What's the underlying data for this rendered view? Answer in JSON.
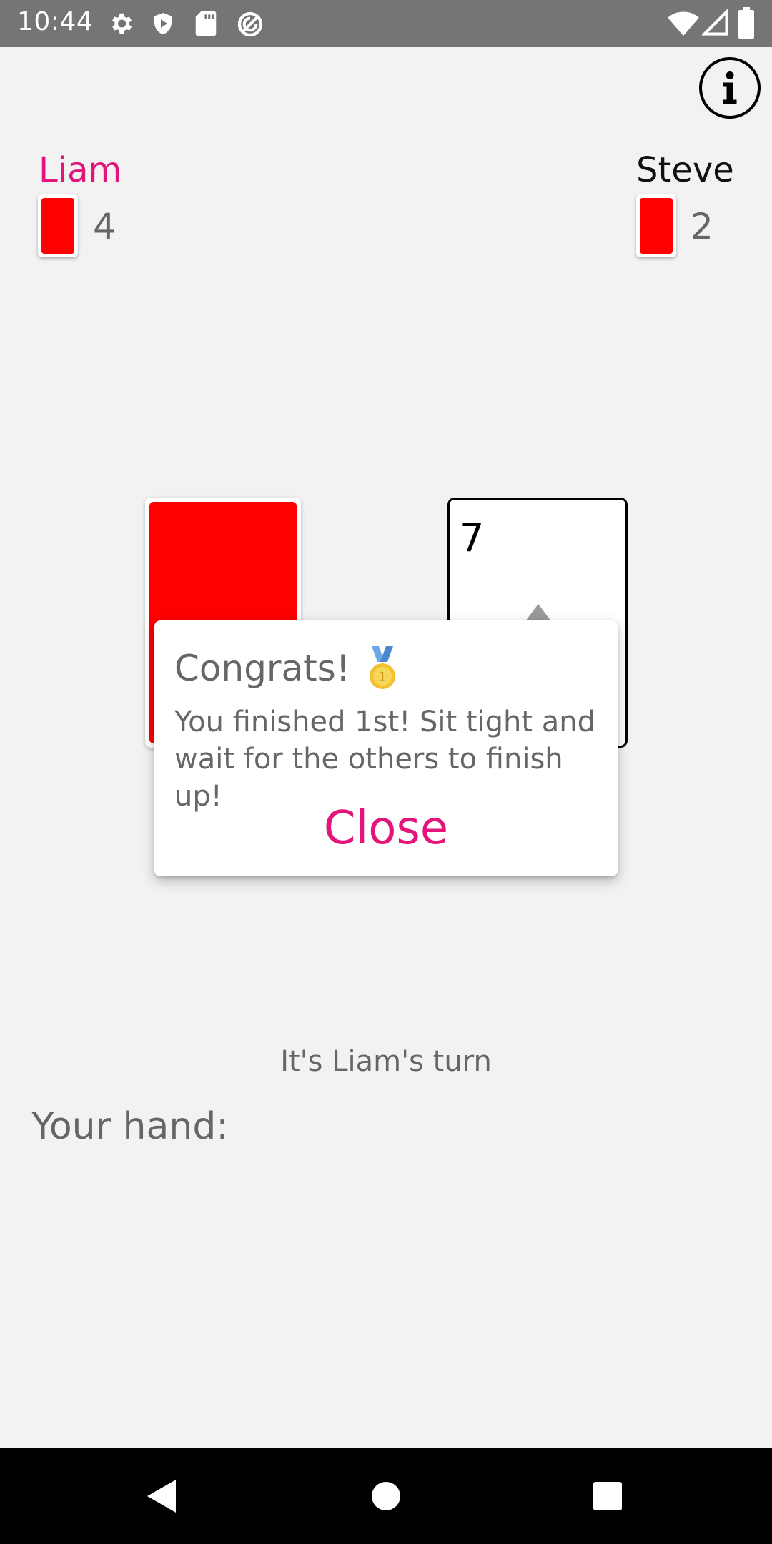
{
  "status_bar": {
    "time": "10:44",
    "left_icons": [
      "gear-icon",
      "shield-icon",
      "sd-card-icon",
      "no-sync-icon"
    ],
    "right_icons": [
      "wifi-icon",
      "signal-icon",
      "battery-icon"
    ]
  },
  "header": {
    "info_icon": "info-icon"
  },
  "players": [
    {
      "name": "Liam",
      "card_count": "4",
      "color": "#e4157a",
      "is_current_turn": true
    },
    {
      "name": "Steve",
      "card_count": "2",
      "color": "#111111",
      "is_current_turn": false
    }
  ],
  "table": {
    "deck_color": "#ff0000",
    "discard": {
      "rank": "7",
      "suit_icon": "diamond-icon",
      "suit_color": "#999999"
    }
  },
  "dialog": {
    "title": "Congrats!",
    "title_icon": "first-place-medal-icon",
    "body": "You finished 1st! Sit tight and wait for the others to finish up!",
    "close_label": "Close",
    "accent_color": "#e4157a"
  },
  "turn": {
    "text": "It's Liam's turn"
  },
  "hand": {
    "label": "Your hand:",
    "cards": []
  },
  "nav_bar": {
    "buttons": [
      "back-icon",
      "home-icon",
      "recents-icon"
    ]
  }
}
